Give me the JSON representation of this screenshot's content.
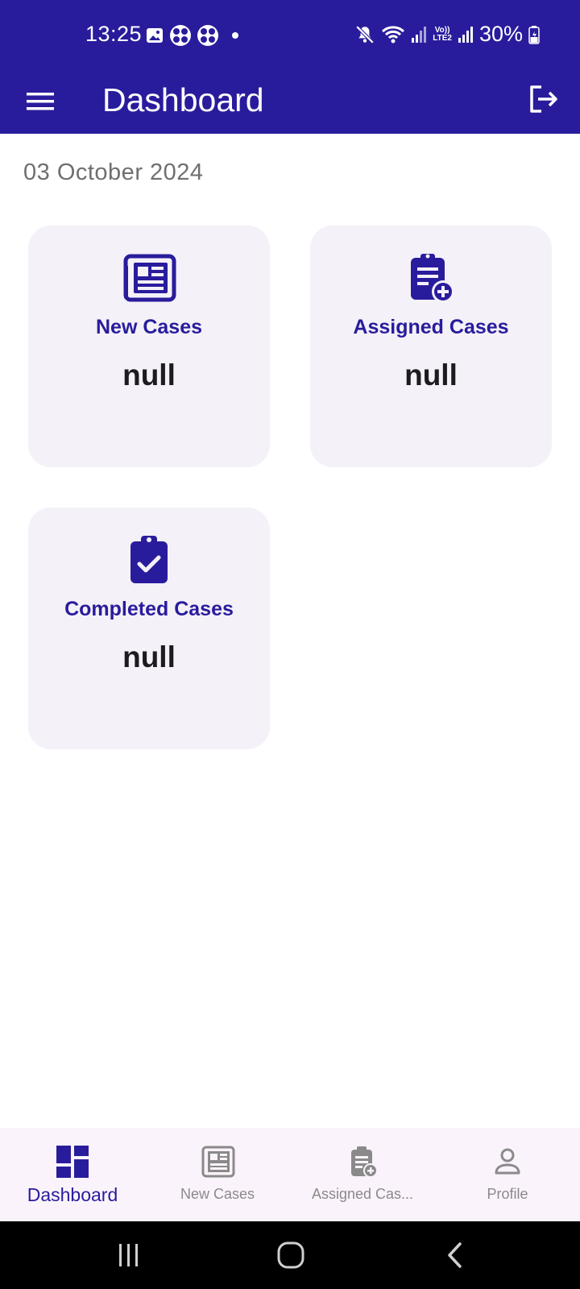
{
  "status_bar": {
    "time": "13:25",
    "battery": "30%",
    "network_badge_top": "Vo))",
    "network_badge_bottom": "LTE2",
    "left_icons": [
      "image-icon",
      "pinwheel-icon",
      "pinwheel-icon",
      "dot-icon"
    ],
    "right_icons": [
      "mute-icon",
      "wifi-icon",
      "signal-icon",
      "signal-icon",
      "battery-charging-icon"
    ]
  },
  "app_bar": {
    "title": "Dashboard",
    "left_icon": "menu-icon",
    "right_icon": "logout-icon",
    "background": "#291c9c"
  },
  "date": "03 October 2024",
  "cards": [
    {
      "title": "New Cases",
      "value": "null",
      "icon": "newspaper-icon"
    },
    {
      "title": "Assigned Cases",
      "value": "null",
      "icon": "clipboard-add-icon"
    },
    {
      "title": "Completed Cases",
      "value": "null",
      "icon": "clipboard-check-icon"
    }
  ],
  "bottom_nav": {
    "items": [
      {
        "label": "Dashboard",
        "icon": "dashboard-icon",
        "active": true
      },
      {
        "label": "New Cases",
        "icon": "newspaper-icon",
        "active": false
      },
      {
        "label": "Assigned Cas...",
        "icon": "clipboard-add-icon",
        "active": false
      },
      {
        "label": "Profile",
        "icon": "person-icon",
        "active": false
      }
    ]
  },
  "system_nav": [
    "recents-icon",
    "home-icon",
    "back-icon"
  ],
  "colors": {
    "primary": "#291c9c",
    "card_background": "#f4f1f8",
    "date_text": "#6f6f6f",
    "inactive_nav": "#8a8a8a"
  }
}
